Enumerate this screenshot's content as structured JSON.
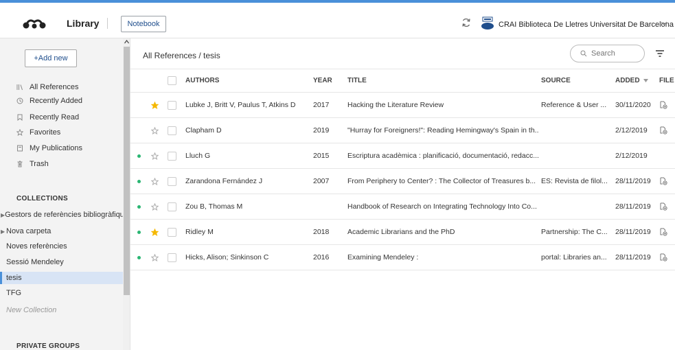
{
  "colors": {
    "accent": "#4a90d9",
    "brand_text": "#1f4e8c",
    "unread_dot": "#2bb673",
    "star_filled": "#f5b800",
    "selected_bg": "#d8e4f5"
  },
  "header": {
    "app_title": "Library",
    "notebook_label": "Notebook",
    "institution": "CRAI Biblioteca De Lletres Universitat De Barcelona",
    "logo_icon": "mendeley-logo-icon",
    "sync_icon": "sync-icon",
    "institution_logo": "crai-logo"
  },
  "sidebar": {
    "add_new_label": "+Add new",
    "nav": [
      {
        "label": "All References",
        "icon": "library-icon"
      },
      {
        "label": "Recently Added",
        "icon": "clock-icon"
      },
      {
        "label": "Recently Read",
        "icon": "bookmark-icon"
      },
      {
        "label": "Favorites",
        "icon": "star-icon"
      },
      {
        "label": "My Publications",
        "icon": "publication-icon"
      },
      {
        "label": "Trash",
        "icon": "trash-icon"
      }
    ],
    "collections_title": "COLLECTIONS",
    "collections": [
      {
        "label": "Gestors de referències bibliogràfiques",
        "expandable": true
      },
      {
        "label": "Nova carpeta",
        "expandable": true
      },
      {
        "label": "Noves referències",
        "expandable": false
      },
      {
        "label": "Sessió Mendeley",
        "expandable": false
      },
      {
        "label": "tesis",
        "expandable": false,
        "selected": true
      },
      {
        "label": "TFG",
        "expandable": false
      }
    ],
    "new_collection_label": "New Collection",
    "private_groups_title": "PRIVATE GROUPS"
  },
  "main": {
    "breadcrumb": "All References / tesis",
    "search_placeholder": "Search",
    "columns": {
      "authors": "AUTHORS",
      "year": "YEAR",
      "title": "TITLE",
      "source": "SOURCE",
      "added": "ADDED",
      "file": "FILE"
    },
    "rows": [
      {
        "unread": false,
        "favorite": true,
        "authors": "Lubke J, Britt V, Paulus T, Atkins D",
        "year": "2017",
        "title": "Hacking the Literature Review",
        "source": "Reference & User ...",
        "added": "30/11/2020",
        "file": true
      },
      {
        "unread": false,
        "favorite": false,
        "authors": "Clapham D",
        "year": "2019",
        "title": "\"Hurray for Foreigners!\": Reading Hemingway's Spain in th...",
        "source": "",
        "added": "2/12/2019",
        "file": true
      },
      {
        "unread": true,
        "favorite": false,
        "authors": "Lluch G",
        "year": "2015",
        "title": "Escriptura acadèmica : planificació, documentació, redacc...",
        "source": "",
        "added": "2/12/2019",
        "file": false
      },
      {
        "unread": true,
        "favorite": false,
        "authors": "Zarandona Fernández J",
        "year": "2007",
        "title": "From Periphery to Center? : The Collector of Treasures b...",
        "source": "ES: Revista de filol...",
        "added": "28/11/2019",
        "file": true
      },
      {
        "unread": true,
        "favorite": false,
        "authors": "Zou B, Thomas M",
        "year": "",
        "title": "Handbook of Research on Integrating Technology Into Co...",
        "source": "",
        "added": "28/11/2019",
        "file": true
      },
      {
        "unread": true,
        "favorite": true,
        "authors": "Ridley M",
        "year": "2018",
        "title": "Academic Librarians and the PhD",
        "source": "Partnership: The C...",
        "added": "28/11/2019",
        "file": true
      },
      {
        "unread": true,
        "favorite": false,
        "authors": "Hicks, Alison; Sinkinson C",
        "year": "2016",
        "title": "Examining Mendeley :",
        "source": "portal: Libraries an...",
        "added": "28/11/2019",
        "file": true
      }
    ]
  }
}
